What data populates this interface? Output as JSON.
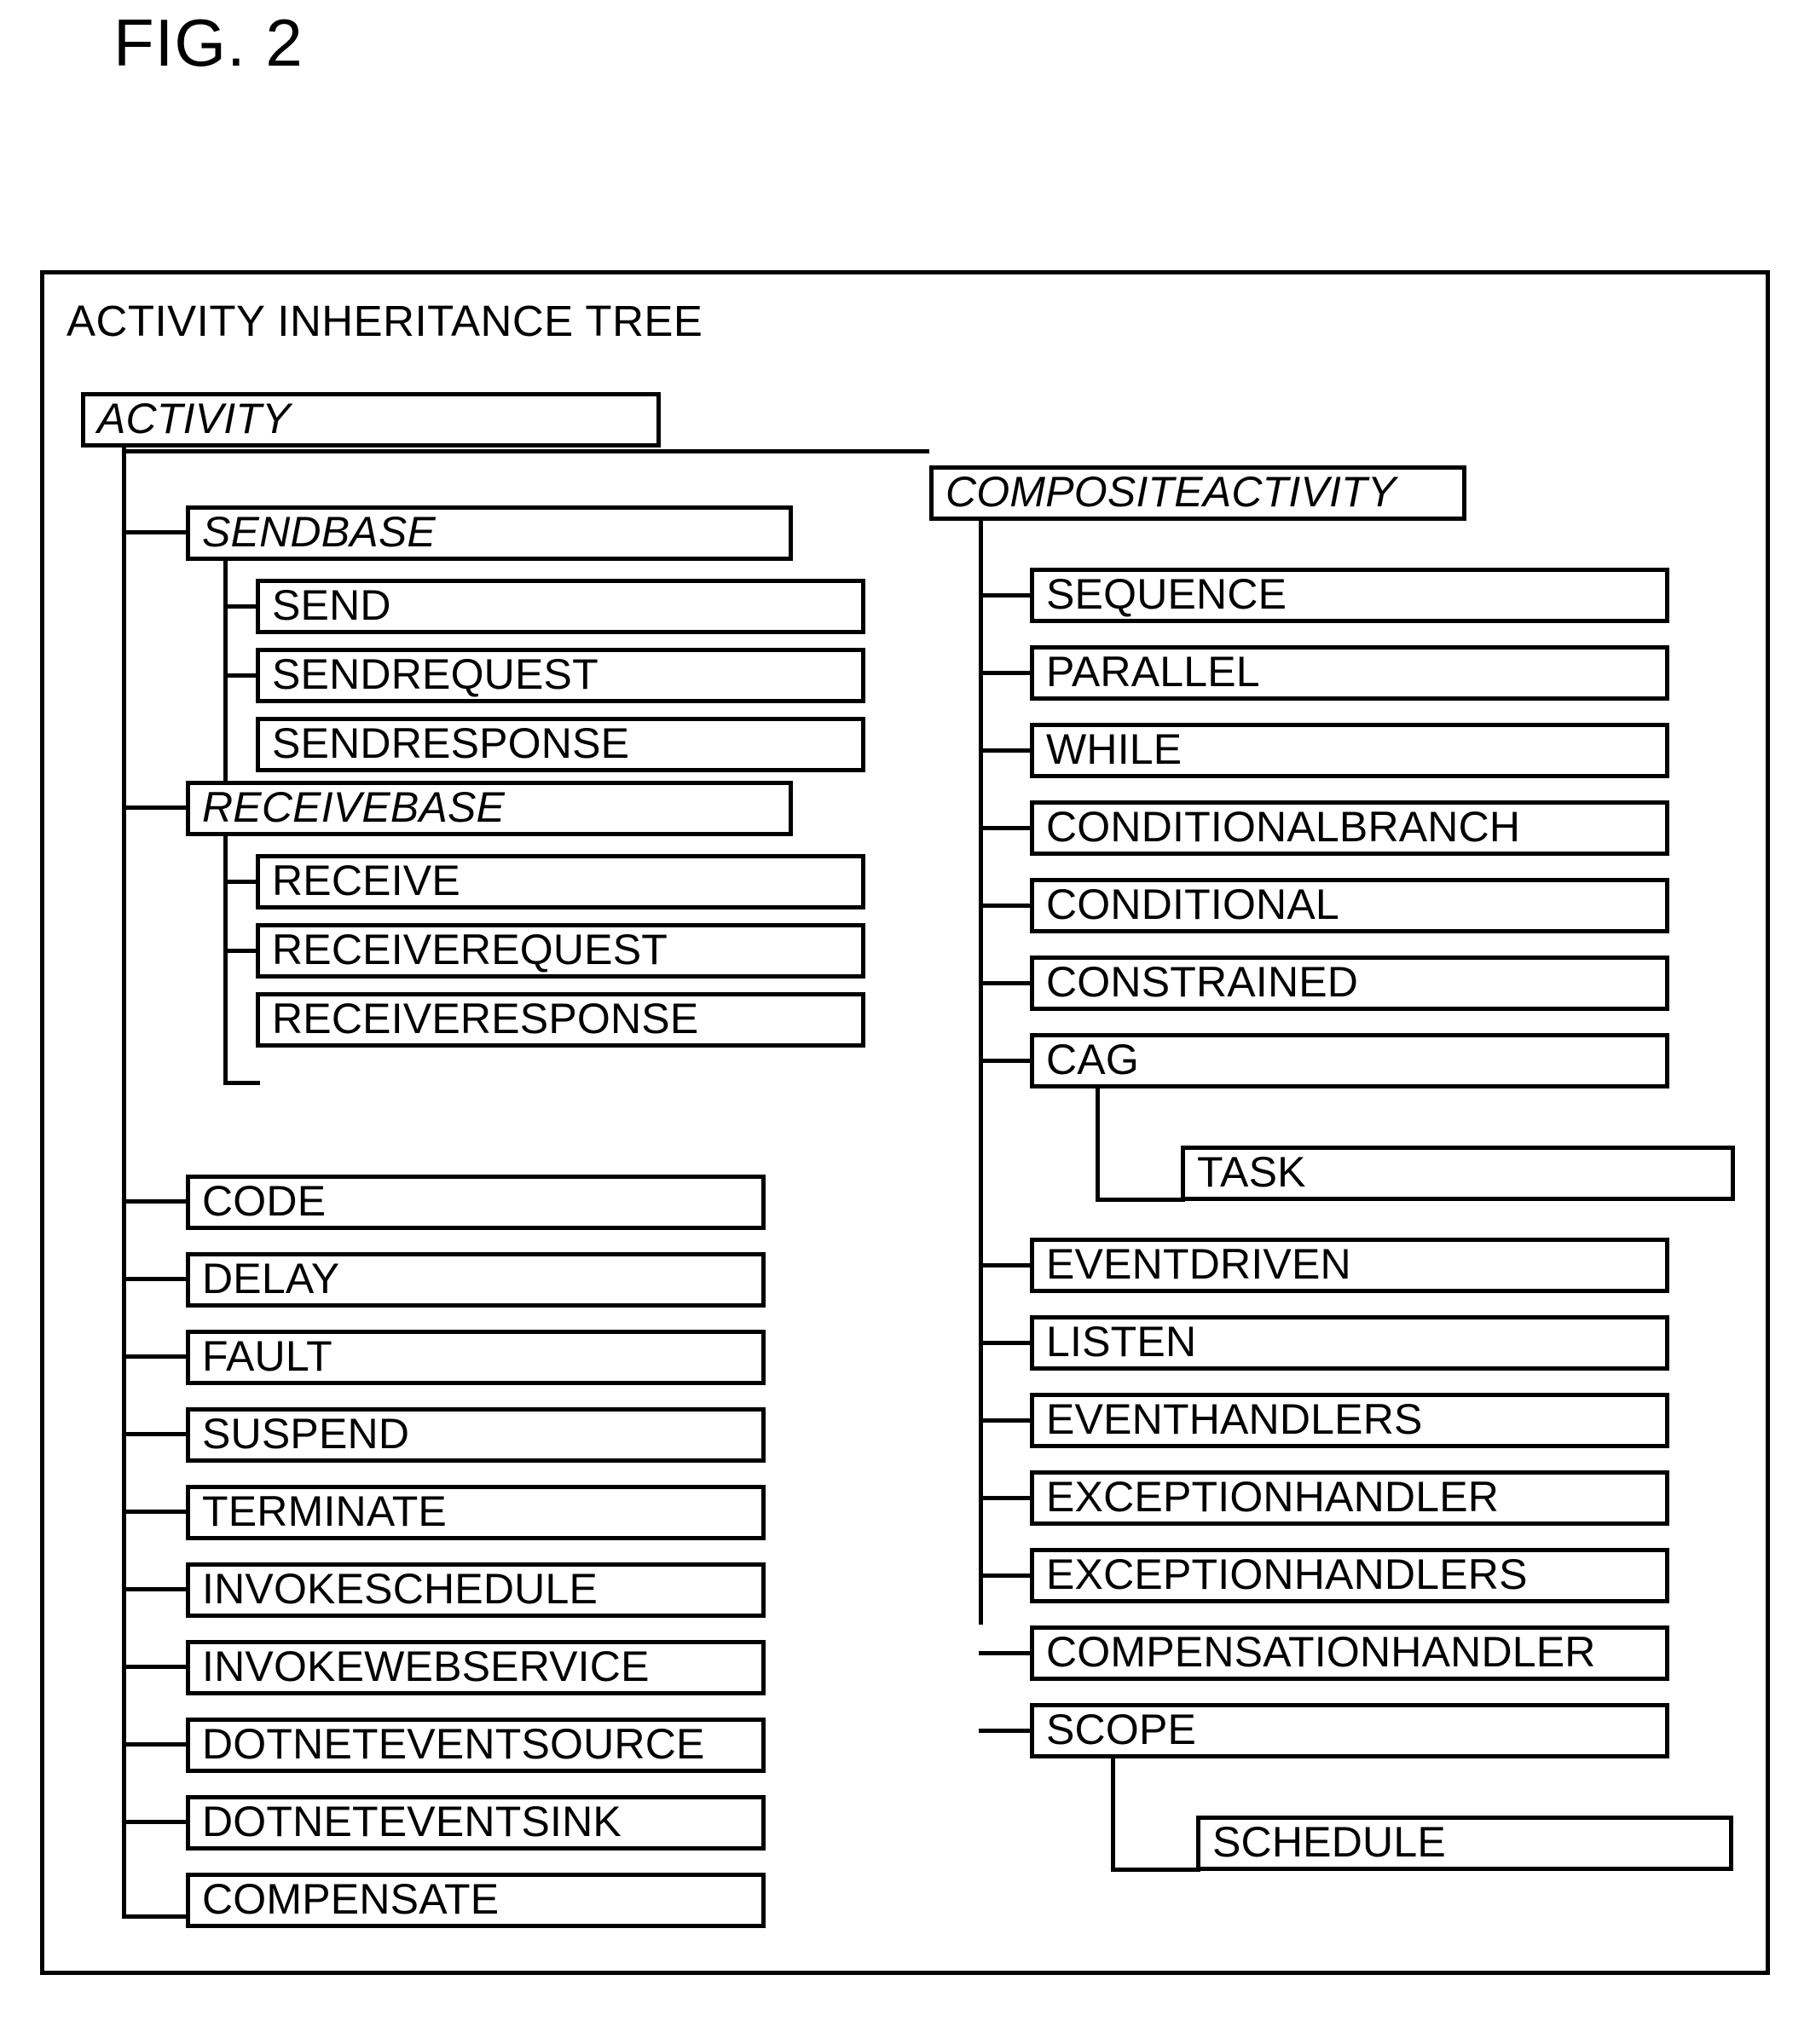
{
  "figure": {
    "title": "FIG. 2",
    "frame_title": "ACTIVITY INHERITANCE TREE"
  },
  "colors": {
    "stroke": "#000000",
    "background": "#ffffff"
  },
  "tree": {
    "root": {
      "label": "ACTIVITY",
      "abstract": true
    },
    "left_branch": [
      {
        "label": "SENDBASE",
        "abstract": true,
        "children": [
          {
            "label": "SEND",
            "abstract": false
          },
          {
            "label": "SENDREQUEST",
            "abstract": false
          },
          {
            "label": "SENDRESPONSE",
            "abstract": false
          }
        ]
      },
      {
        "label": "RECEIVEBASE",
        "abstract": true,
        "children": [
          {
            "label": "RECEIVE",
            "abstract": false
          },
          {
            "label": "RECEIVEREQUEST",
            "abstract": false
          },
          {
            "label": "RECEIVERESPONSE",
            "abstract": false
          }
        ]
      },
      {
        "label": "CODE",
        "abstract": false
      },
      {
        "label": "DELAY",
        "abstract": false
      },
      {
        "label": "FAULT",
        "abstract": false
      },
      {
        "label": "SUSPEND",
        "abstract": false
      },
      {
        "label": "TERMINATE",
        "abstract": false
      },
      {
        "label": "INVOKESCHEDULE",
        "abstract": false
      },
      {
        "label": "INVOKEWEBSERVICE",
        "abstract": false
      },
      {
        "label": "DOTNETEVENTSOURCE",
        "abstract": false
      },
      {
        "label": "DOTNETEVENTSINK",
        "abstract": false
      },
      {
        "label": "COMPENSATE",
        "abstract": false
      }
    ],
    "right_root": {
      "label": "COMPOSITEACTIVITY",
      "abstract": true
    },
    "right_branch": [
      {
        "label": "SEQUENCE",
        "abstract": false
      },
      {
        "label": "PARALLEL",
        "abstract": false
      },
      {
        "label": "WHILE",
        "abstract": false
      },
      {
        "label": "CONDITIONALBRANCH",
        "abstract": false
      },
      {
        "label": "CONDITIONAL",
        "abstract": false
      },
      {
        "label": "CONSTRAINED",
        "abstract": false
      },
      {
        "label": "CAG",
        "abstract": false,
        "children": [
          {
            "label": "TASK",
            "abstract": false
          }
        ]
      },
      {
        "label": "EVENTDRIVEN",
        "abstract": false
      },
      {
        "label": "LISTEN",
        "abstract": false
      },
      {
        "label": "EVENTHANDLERS",
        "abstract": false
      },
      {
        "label": "EXCEPTIONHANDLER",
        "abstract": false
      },
      {
        "label": "EXCEPTIONHANDLERS",
        "abstract": false
      },
      {
        "label": "COMPENSATIONHANDLER",
        "abstract": false
      },
      {
        "label": "SCOPE",
        "abstract": false,
        "children": [
          {
            "label": "SCHEDULE",
            "abstract": false
          }
        ]
      }
    ]
  }
}
